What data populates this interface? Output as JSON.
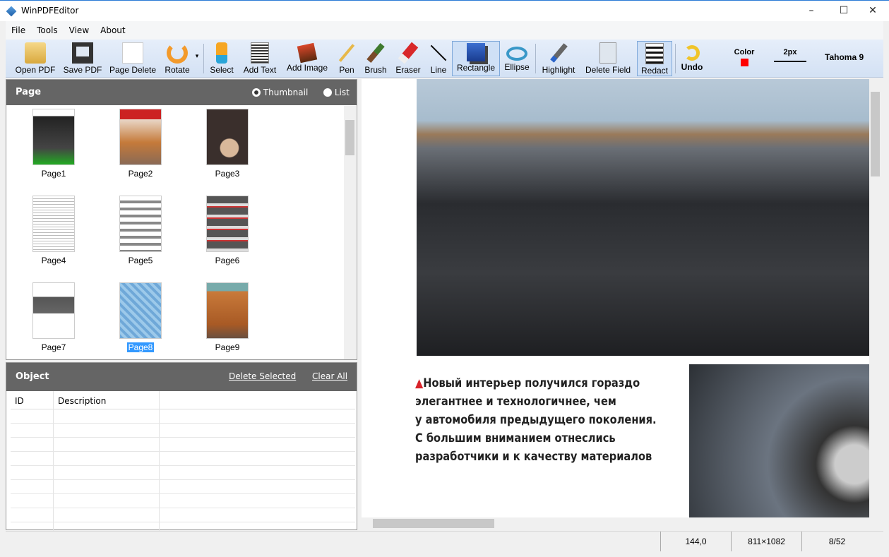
{
  "window": {
    "title": "WinPDFEditor",
    "minimize": "–",
    "maximize": "☐",
    "close": "✕"
  },
  "menu": [
    "File",
    "Tools",
    "View",
    "About"
  ],
  "toolbar": {
    "buttons": [
      {
        "label": "Open PDF",
        "icon": "folder-open-icon"
      },
      {
        "label": "Save PDF",
        "icon": "floppy-icon"
      },
      {
        "label": "Page Delete",
        "icon": "scissors-page-icon"
      },
      {
        "label": "Rotate",
        "icon": "rotate-icon"
      },
      {
        "label": "Select",
        "icon": "hand-pointer-icon"
      },
      {
        "label": "Add Text",
        "icon": "text-icon"
      },
      {
        "label": "Add Image",
        "icon": "image-icon"
      },
      {
        "label": "Pen",
        "icon": "pencil-icon"
      },
      {
        "label": "Brush",
        "icon": "brush-icon"
      },
      {
        "label": "Eraser",
        "icon": "eraser-icon"
      },
      {
        "label": "Line",
        "icon": "line-icon"
      },
      {
        "label": "Rectangle",
        "icon": "rectangle-icon"
      },
      {
        "label": "Ellipse",
        "icon": "ellipse-icon"
      },
      {
        "label": "Highlight",
        "icon": "highlighter-icon"
      },
      {
        "label": "Delete Field",
        "icon": "delete-field-icon"
      },
      {
        "label": "Redact",
        "icon": "redact-icon"
      },
      {
        "label": "Undo",
        "icon": "undo-icon"
      }
    ],
    "color_label": "Color",
    "color_value": "#ff0000",
    "width_label": "2px",
    "font_label": "Tahoma 9",
    "rotate_dropdown": "▾"
  },
  "page_panel": {
    "title": "Page",
    "view_options": [
      "Thumbnail",
      "List"
    ],
    "selected_view": "Thumbnail",
    "pages": [
      "Page1",
      "Page2",
      "Page3",
      "Page4",
      "Page5",
      "Page6",
      "Page7",
      "Page8",
      "Page9"
    ],
    "selected_page": "Page8"
  },
  "object_panel": {
    "title": "Object",
    "delete_selected": "Delete Selected",
    "clear_all": "Clear All",
    "columns": [
      "ID",
      "Description"
    ]
  },
  "document": {
    "caption": "Новый интерьер получился гораздо элегантнее и технологичнее, чем у автомобиля предыдущего поколения. С большим вниманием отнеслись разработчики и к качеству материалов",
    "caption_lines": [
      "Новый интерьер получился гораздо",
      "элегантнее и технологичнее, чем",
      "у автомобиля предыдущего поколения.",
      "С большим вниманием отнеслись",
      "разработчики и к качеству материалов"
    ]
  },
  "status": {
    "coords": "144,0",
    "size": "811×1082",
    "page": "8/52"
  }
}
